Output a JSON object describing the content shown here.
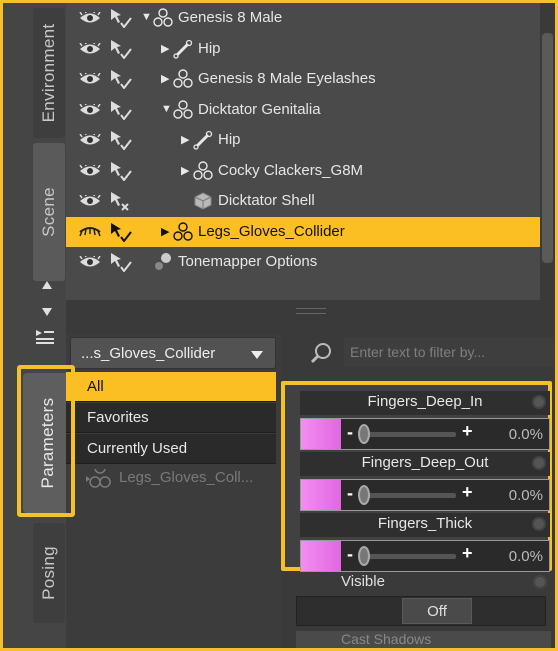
{
  "side_tabs": {
    "environment": "Environment",
    "scene": "Scene",
    "parameters": "Parameters",
    "posing": "Posing"
  },
  "scene_rows": [
    {
      "label": "Genesis 8 Male",
      "expand": "down",
      "icon": "figure-icon"
    },
    {
      "label": "Hip",
      "expand": "right",
      "icon": "bone-icon"
    },
    {
      "label": "Genesis 8 Male Eyelashes",
      "expand": "right",
      "icon": "figure-icon"
    },
    {
      "label": "Dicktator Genitalia",
      "expand": "down",
      "icon": "figure-icon"
    },
    {
      "label": "Hip",
      "expand": "right",
      "icon": "bone-icon"
    },
    {
      "label": "Cocky Clackers_G8M",
      "expand": "right",
      "icon": "figure-icon"
    },
    {
      "label": "Dicktator Shell",
      "expand": "none",
      "icon": "prop-icon"
    },
    {
      "label": "Legs_Gloves_Collider",
      "expand": "right",
      "icon": "figure-icon",
      "selected": true
    },
    {
      "label": "Tonemapper Options",
      "expand": "none",
      "icon": "tonemapper-icon"
    }
  ],
  "node_dropdown": "...s_Gloves_Collider",
  "categories": [
    "All",
    "Favorites",
    "Currently Used"
  ],
  "selected_category": "All",
  "node_tree_item": "Legs_Gloves_Coll...",
  "filter_placeholder": "Enter text to filter by...",
  "morphs": [
    {
      "name": "Fingers_Deep_In",
      "value": "0.0%",
      "fill": 0.0
    },
    {
      "name": "Fingers_Deep_Out",
      "value": "0.0%",
      "fill": 0.0
    },
    {
      "name": "Fingers_Thick",
      "value": "0.0%",
      "fill": 0.0
    }
  ],
  "slider_minus": "-",
  "slider_plus": "+",
  "visible_label": "Visible",
  "visible_toggle": "Off",
  "cast_shadows_label": "Cast Shadows",
  "colors": {
    "highlight": "#fbbf24",
    "annotation_border": "#f6c02c",
    "morph_fill": "#f38df3"
  }
}
